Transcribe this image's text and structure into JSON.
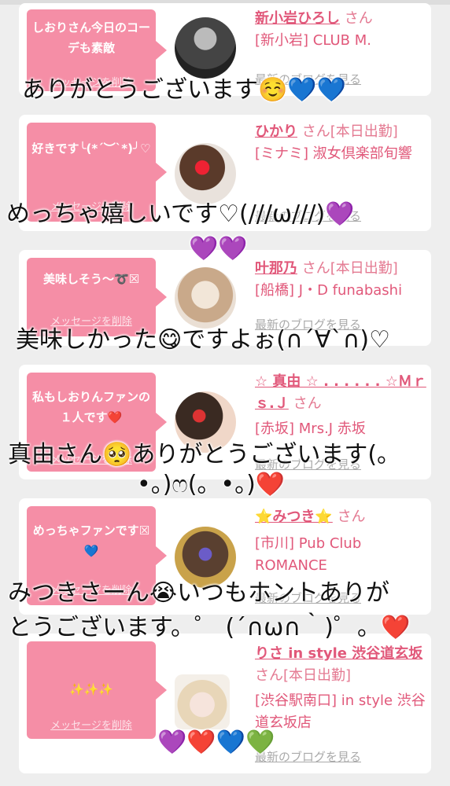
{
  "cards": [
    {
      "message": "しおりさん今日のコーデも素敵",
      "delete": "メッセージを削除",
      "name": "新小岩ひろし",
      "suffix": "さん",
      "shop": "[新小岩] CLUB M.",
      "blog": "最新のブログを見る"
    },
    {
      "message": "好きです╰(*´︶`*)╯♡",
      "delete": "メッセージを削除",
      "name": "ひかり",
      "suffix": "さん[本日出勤]",
      "shop": "[ミナミ] 淑女倶楽部旬響",
      "blog": "最新のブログを見る"
    },
    {
      "message": "美味しそう〜➰☒",
      "delete": "メッセージを削除",
      "name": "叶那乃",
      "suffix": "さん[本日出勤]",
      "shop": "[船橋] J・D funabashi",
      "blog": "最新のブログを見る"
    },
    {
      "message": "私もしおりんファンの１人です❤️",
      "delete": "メッセージを削除",
      "name": "☆ 真由 ☆ . . . . . . ☆Ｍｒｓ.Ｊ",
      "suffix": "さん",
      "shop": "[赤坂] Mrs.J 赤坂",
      "blog": "最新のブログを見る"
    },
    {
      "message": "めっちゃファンです☒💙",
      "delete": "メッセージを削除",
      "name": "⭐みつき⭐",
      "suffix": "さん",
      "shop": "[市川] Pub Club ROMANCE",
      "blog": "最新のブログを見る"
    },
    {
      "message": "✨✨✨",
      "delete": "メッセージを削除",
      "name": "りさ in style 渋谷道玄坂",
      "suffix": "さん[本日出勤]",
      "shop": "[渋谷駅南口] in style 渋谷道玄坂店",
      "blog": "最新のブログを見る"
    }
  ],
  "captions": [
    "ありがとうございます☺️💙💙",
    "めっちゃ嬉しいです♡(///ω///)💜",
    "💜💜",
    "美味しかった😋ですよぉ(∩´∀`∩)♡",
    "真由さん🥺ありがとうございます(。",
    "•。)ෆ(。•。)❤️",
    "みつきさーん😭いつもホントありが",
    "とうございます。゜ (´∩ω∩｀)゜。❤️",
    "💜❤️💙💚"
  ],
  "colors": {
    "bubble": "#f58ea6",
    "name": "#e1587a",
    "background": "#eeeeee"
  }
}
